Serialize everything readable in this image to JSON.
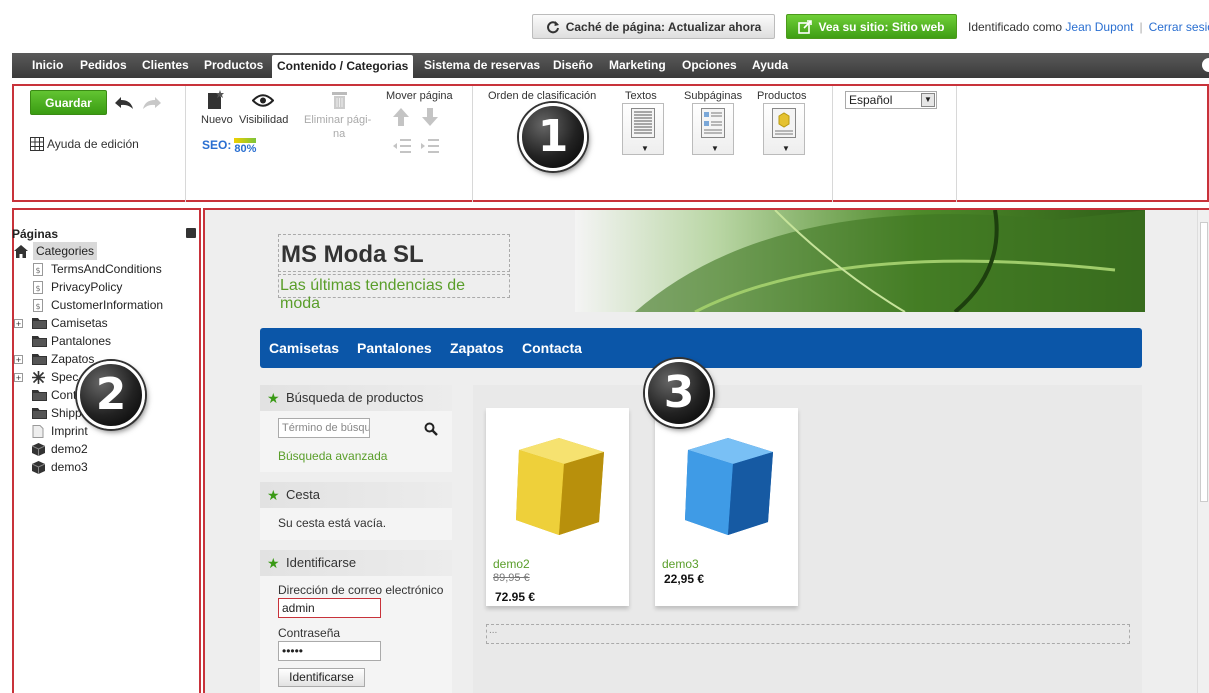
{
  "topbar": {
    "cache_button": "Caché de página: Actualizar ahora",
    "site_button": "Vea su sitio: Sitio web",
    "logged_as": "Identificado como",
    "user_name": "Jean Dupont",
    "logout": "Cerrar sesión"
  },
  "menu": {
    "items": [
      "Inicio",
      "Pedidos",
      "Clientes",
      "Productos",
      "Contenido / Categorias",
      "Sistema de reservas",
      "Diseño",
      "Marketing",
      "Opciones",
      "Ayuda"
    ]
  },
  "toolbar": {
    "save": "Guardar",
    "edit_help": "Ayuda de edición",
    "new": "Nuevo",
    "visibility": "Visibilidad",
    "delete_page_1": "Eliminar pági-",
    "delete_page_2": "na",
    "seo_label": "SEO:",
    "seo_value": "80%",
    "seo_progress": 0.8,
    "move_page": "Mover página",
    "sort_order": "Orden de clasificación",
    "texts": "Textos",
    "subpages": "Subpáginas",
    "products": "Productos",
    "language": "Español"
  },
  "callouts": [
    "1",
    "2",
    "3"
  ],
  "sidebar": {
    "title": "Páginas",
    "items": [
      {
        "label": "Categories",
        "icon": "home-icon"
      },
      {
        "label": "TermsAndConditions",
        "icon": "page-dollar-icon"
      },
      {
        "label": "PrivacyPolicy",
        "icon": "page-dollar-icon"
      },
      {
        "label": "CustomerInformation",
        "icon": "page-dollar-icon"
      },
      {
        "label": "Camisetas",
        "icon": "folder-icon"
      },
      {
        "label": "Pantalones",
        "icon": "folder-icon"
      },
      {
        "label": "Zapatos",
        "icon": "folder-icon"
      },
      {
        "label": "Spec",
        "icon": "star-icon"
      },
      {
        "label": "Cont",
        "icon": "folder-icon"
      },
      {
        "label": "Shipping",
        "icon": "folder-icon"
      },
      {
        "label": "Imprint",
        "icon": "page-icon"
      },
      {
        "label": "demo2",
        "icon": "box-icon"
      },
      {
        "label": "demo3",
        "icon": "box-icon"
      }
    ]
  },
  "site": {
    "title": "MS Moda SL",
    "subtitle": "Las últimas tendencias de moda",
    "nav": [
      "Camisetas",
      "Pantalones",
      "Zapatos",
      "Contacta"
    ],
    "search_title": "Búsqueda de productos",
    "search_placeholder": "Término de búsqueda",
    "advanced_search": "Búsqueda avanzada",
    "cart_title": "Cesta",
    "cart_empty": "Su cesta está vacía.",
    "login_title": "Identificarse",
    "email_label": "Dirección de correo electrónico",
    "email_value": "admin",
    "password_label": "Contraseña",
    "password_value": "•••••",
    "login_button": "Identificarse",
    "products": [
      {
        "name": "demo2",
        "old_price": "89,95 €",
        "price": "72.95 €",
        "color": "#e7c52a"
      },
      {
        "name": "demo3",
        "old_price": "",
        "price": "22,95 €",
        "color": "#2f8ee0"
      }
    ],
    "placeholder_dots": "..."
  }
}
